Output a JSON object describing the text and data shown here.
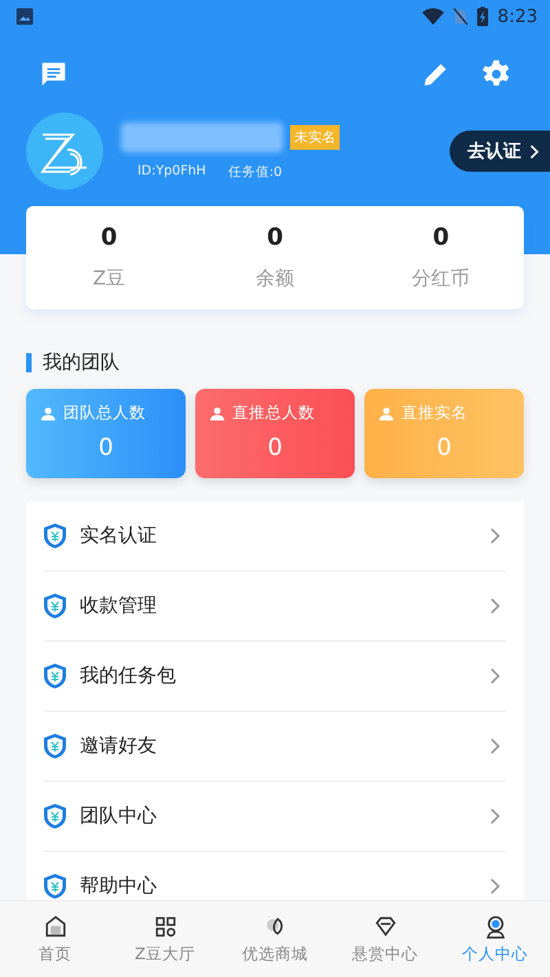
{
  "status_bar": {
    "time": "8:23"
  },
  "profile": {
    "verify_tag": "未实名",
    "id": "ID:Yp0FhH",
    "task_value": "任务值:0",
    "verify_button": "去认证"
  },
  "stats": [
    {
      "value": "0",
      "label": "Z豆"
    },
    {
      "value": "0",
      "label": "余额"
    },
    {
      "value": "0",
      "label": "分红币"
    }
  ],
  "team": {
    "title": "我的团队",
    "cards": [
      {
        "label": "团队总人数",
        "value": "0",
        "kind": "blue"
      },
      {
        "label": "直推总人数",
        "value": "0",
        "kind": "red"
      },
      {
        "label": "直推实名",
        "value": "0",
        "kind": "orange"
      }
    ]
  },
  "menu": [
    {
      "label": "实名认证"
    },
    {
      "label": "收款管理"
    },
    {
      "label": "我的任务包"
    },
    {
      "label": "邀请好友"
    },
    {
      "label": "团队中心"
    },
    {
      "label": "帮助中心"
    }
  ],
  "tabs": [
    {
      "label": "首页",
      "selected": false
    },
    {
      "label": "Z豆大厅",
      "selected": false
    },
    {
      "label": "优选商城",
      "selected": false
    },
    {
      "label": "悬赏中心",
      "selected": false
    },
    {
      "label": "个人中心",
      "selected": true
    }
  ]
}
